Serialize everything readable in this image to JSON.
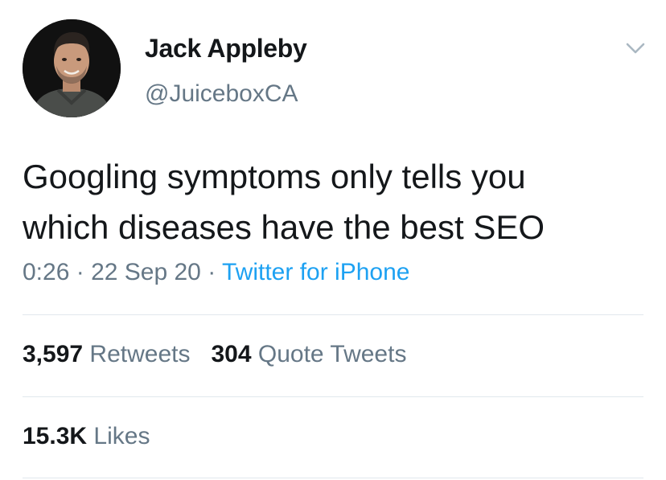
{
  "tweet": {
    "author": {
      "name": "Jack Appleby",
      "handle": "@JuiceboxCA",
      "avatar_icon": "profile-photo"
    },
    "text_lines": [
      "Googling symptoms only tells you",
      "which diseases have the best SEO"
    ],
    "time": "0:26",
    "separator": "·",
    "date": "22 Sep 20",
    "source": "Twitter for iPhone",
    "stats": {
      "retweets_count": "3,597",
      "retweets_label": "Retweets",
      "quotes_count": "304",
      "quotes_label": "Quote Tweets",
      "likes_count": "15.3K",
      "likes_label": "Likes"
    },
    "more_icon": "chevron-down-icon"
  },
  "colors": {
    "text": "#14171a",
    "secondary": "#657786",
    "link": "#1da1f2",
    "divider": "#e1e8ed"
  }
}
